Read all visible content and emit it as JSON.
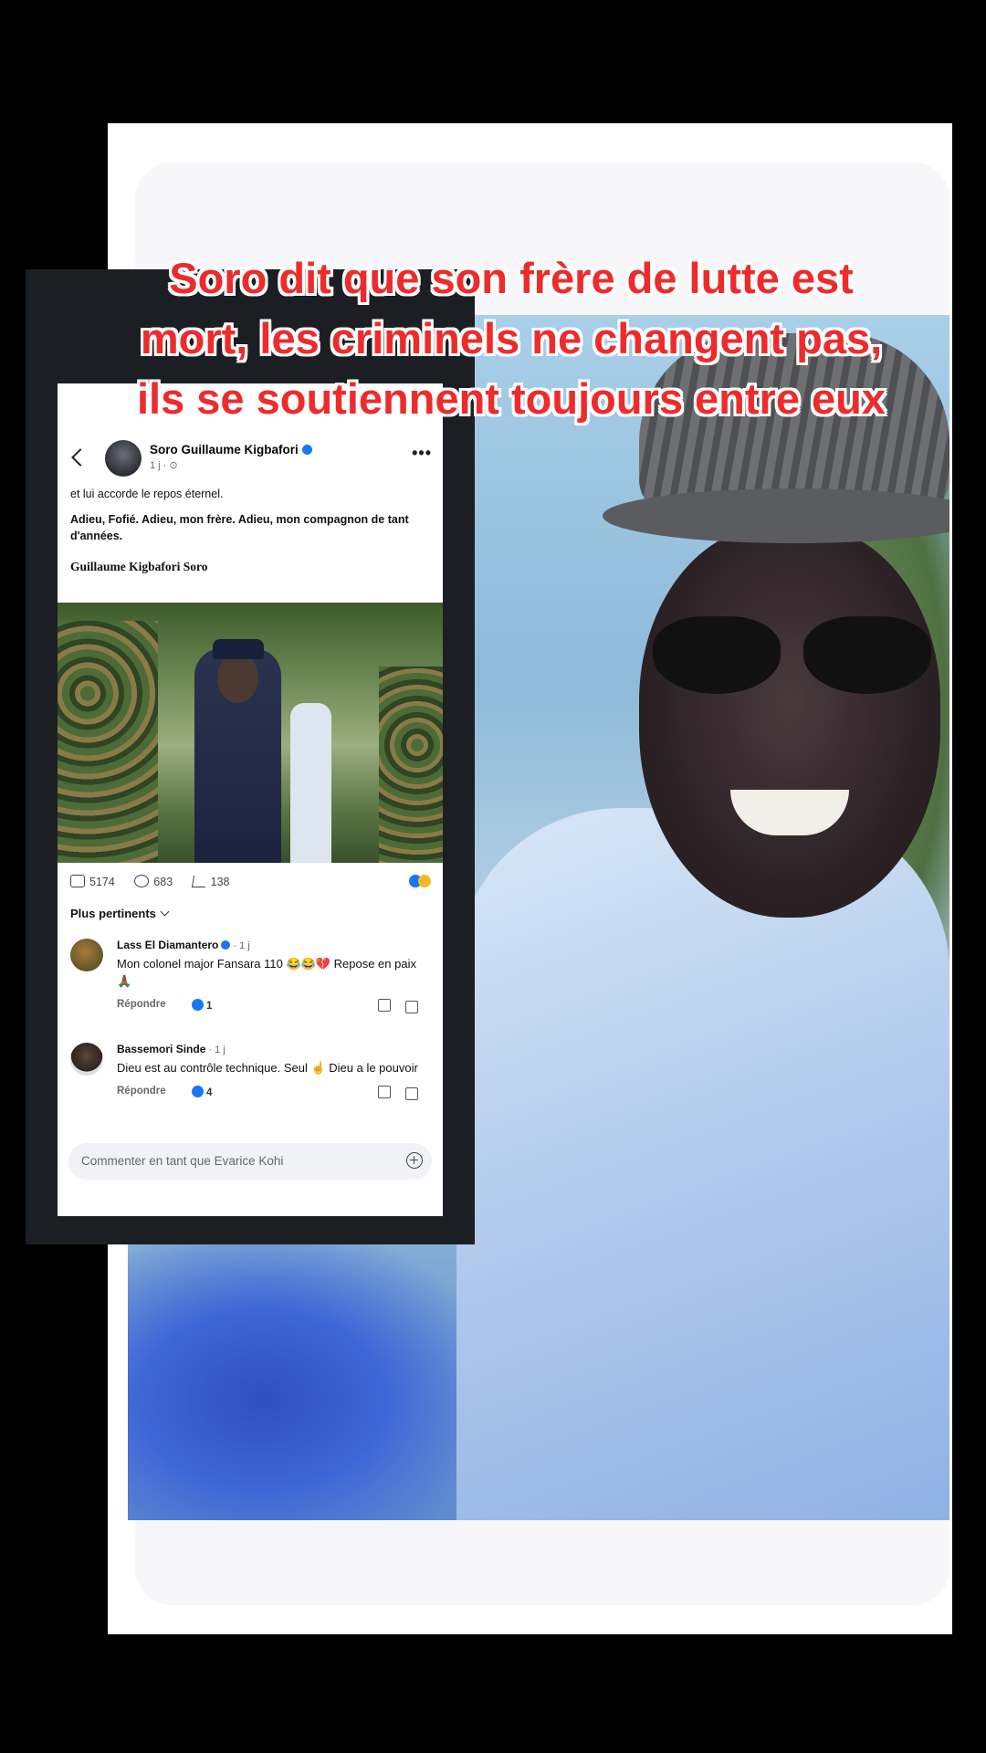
{
  "headline": {
    "line1": "Soro dit que son frère de lutte est",
    "line2": "mort, les criminels ne changent pas,",
    "line3": "ils se soutiennent toujours entre eux"
  },
  "post": {
    "author": "Soro Guillaume Kigbafori",
    "meta": "1 j · ⊙",
    "text_1": "et lui accorde le repos éternel.",
    "text_2": "Adieu, Fofié. Adieu, mon frère. Adieu, mon compagnon de tant d'années.",
    "signature": "Guillaume Kigbafori Soro",
    "likes": "5174",
    "comments": "683",
    "shares": "138",
    "sort_label": "Plus pertinents"
  },
  "comments": [
    {
      "author": "Lass El Diamantero",
      "time": " · 1 j",
      "text": "Mon colonel major Fansara 110 😂😂💔 Repose en paix 🙏🏾",
      "reply_label": "Répondre",
      "like_count": "1"
    },
    {
      "author": "Bassemori Sinde",
      "time": " · 1 j",
      "text": "Dieu est au contrôle technique. Seul ☝️ Dieu a le pouvoir",
      "reply_label": "Répondre",
      "like_count": "4"
    }
  ],
  "composer": {
    "placeholder": "Commenter en tant que Evarice Kohi"
  },
  "colors": {
    "headline": "#ee2b2b",
    "facebook_blue": "#1877f2"
  }
}
